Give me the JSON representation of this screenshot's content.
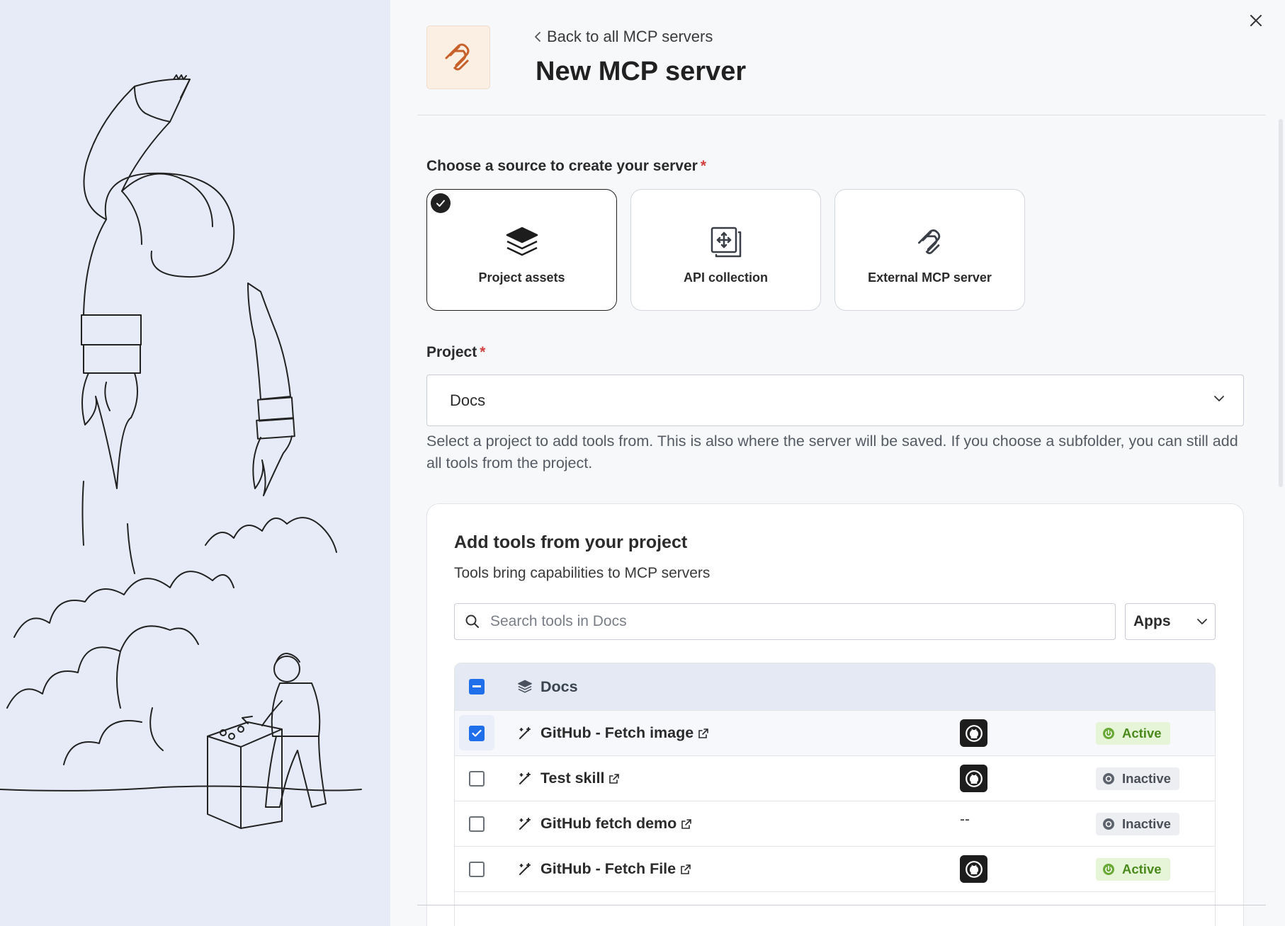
{
  "header": {
    "back_label": "Back to all MCP servers",
    "title": "New MCP server"
  },
  "source": {
    "label": "Choose a source to create your server",
    "required_mark": "*",
    "options": [
      {
        "label": "Project assets",
        "icon": "layers-icon",
        "selected": true
      },
      {
        "label": "API collection",
        "icon": "api-collection-icon",
        "selected": false
      },
      {
        "label": "External MCP server",
        "icon": "mcp-logo-icon",
        "selected": false
      }
    ]
  },
  "project": {
    "label": "Project",
    "required_mark": "*",
    "value": "Docs",
    "help": "Select a project to add tools from. This is also where the server will be saved. If you choose a subfolder, you can still add all tools from the project."
  },
  "tools": {
    "title": "Add tools from your project",
    "subtitle": "Tools bring capabilities to MCP servers",
    "search_placeholder": "Search tools in Docs",
    "filter_value": "Apps",
    "group_name": "Docs",
    "rows": [
      {
        "name": "GitHub - Fetch image",
        "checked": true,
        "app": "github",
        "status": "Active"
      },
      {
        "name": "Test skill",
        "checked": false,
        "app": "github",
        "status": "Inactive"
      },
      {
        "name": "GitHub fetch demo",
        "checked": false,
        "app": "--",
        "status": "Inactive"
      },
      {
        "name": "GitHub - Fetch File",
        "checked": false,
        "app": "github",
        "status": "Active"
      }
    ]
  },
  "colors": {
    "accent": "#1f6feb",
    "active_bg": "#e6f4d8",
    "active_text": "#4a8a1c",
    "logo_orange": "#c8602a",
    "required": "#d23f3f"
  }
}
